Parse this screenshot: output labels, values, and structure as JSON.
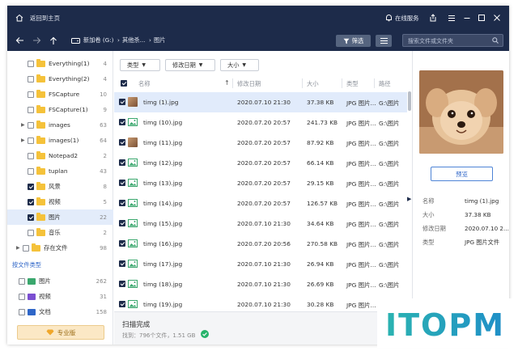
{
  "titlebar": {
    "back_home": "返回到主页",
    "online_service": "在线服务"
  },
  "nav": {
    "crumbs": [
      "新加卷 (G:)",
      "其他杀...",
      "图片"
    ],
    "filter_label": "筛选",
    "search_placeholder": "搜索文件或文件夹"
  },
  "sidebar": {
    "folders": [
      {
        "name": "Everything(1)",
        "count": "4",
        "checked": false,
        "expandable": false
      },
      {
        "name": "Everything(2)",
        "count": "4",
        "checked": false,
        "expandable": false
      },
      {
        "name": "FSCapture",
        "count": "10",
        "checked": false,
        "expandable": false
      },
      {
        "name": "FSCapture(1)",
        "count": "9",
        "checked": false,
        "expandable": false
      },
      {
        "name": "images",
        "count": "63",
        "checked": false,
        "expandable": true
      },
      {
        "name": "images(1)",
        "count": "64",
        "checked": false,
        "expandable": true
      },
      {
        "name": "Notepad2",
        "count": "2",
        "checked": false,
        "expandable": false
      },
      {
        "name": "tuplan",
        "count": "43",
        "checked": false,
        "expandable": false
      },
      {
        "name": "风景",
        "count": "8",
        "checked": true,
        "expandable": false
      },
      {
        "name": "视频",
        "count": "5",
        "checked": true,
        "expandable": false
      },
      {
        "name": "图片",
        "count": "22",
        "checked": true,
        "expandable": false,
        "selected": true
      },
      {
        "name": "音乐",
        "count": "2",
        "checked": false,
        "expandable": false
      }
    ],
    "saved_files": {
      "name": "存在文件",
      "count": "98"
    },
    "by_type_title": "按文件类型",
    "types": [
      {
        "name": "图片",
        "count": "262",
        "color": "#3aa76d"
      },
      {
        "name": "视频",
        "count": "31",
        "color": "#7b4fd1"
      },
      {
        "name": "文档",
        "count": "158",
        "color": "#2f66c8"
      }
    ],
    "pro_label": "专业版"
  },
  "filters": {
    "type": "类型",
    "modified": "修改日期",
    "size": "大小"
  },
  "table": {
    "headers": {
      "name": "名称",
      "modified": "修改日期",
      "size": "大小",
      "type": "类型",
      "path": "路径"
    },
    "rows": [
      {
        "name": "timg (1).jpg",
        "modified": "2020.07.10 21:30",
        "size": "37.38 KB",
        "type": "JPG 图片...",
        "path": "G:\\图片",
        "thumb": true
      },
      {
        "name": "timg (10).jpg",
        "modified": "2020.07.20 20:57",
        "size": "241.73 KB",
        "type": "JPG 图片...",
        "path": "G:\\图片",
        "thumb": false
      },
      {
        "name": "timg (11).jpg",
        "modified": "2020.07.20 20:57",
        "size": "87.92 KB",
        "type": "JPG 图片...",
        "path": "G:\\图片",
        "thumb": true
      },
      {
        "name": "timg (12).jpg",
        "modified": "2020.07.20 20:57",
        "size": "66.14 KB",
        "type": "JPG 图片...",
        "path": "G:\\图片",
        "thumb": false
      },
      {
        "name": "timg (13).jpg",
        "modified": "2020.07.20 20:57",
        "size": "29.15 KB",
        "type": "JPG 图片...",
        "path": "G:\\图片",
        "thumb": false
      },
      {
        "name": "timg (14).jpg",
        "modified": "2020.07.20 20:57",
        "size": "126.57 KB",
        "type": "JPG 图片...",
        "path": "G:\\图片",
        "thumb": false
      },
      {
        "name": "timg (15).jpg",
        "modified": "2020.07.10 21:30",
        "size": "34.64 KB",
        "type": "JPG 图片...",
        "path": "G:\\图片",
        "thumb": false
      },
      {
        "name": "timg (16).jpg",
        "modified": "2020.07.20 20:56",
        "size": "270.58 KB",
        "type": "JPG 图片...",
        "path": "G:\\图片",
        "thumb": false
      },
      {
        "name": "timg (17).jpg",
        "modified": "2020.07.10 21:30",
        "size": "26.94 KB",
        "type": "JPG 图片...",
        "path": "G:\\图片",
        "thumb": false
      },
      {
        "name": "timg (18).jpg",
        "modified": "2020.07.10 21:30",
        "size": "26.69 KB",
        "type": "JPG 图片...",
        "path": "G:\\图片",
        "thumb": false
      },
      {
        "name": "timg (19).jpg",
        "modified": "2020.07.10 21:30",
        "size": "30.28 KB",
        "type": "JPG 图片...",
        "path": "G:\\图片",
        "thumb": false
      }
    ]
  },
  "status": {
    "title": "扫描完成",
    "found": "找到：796个文件，1.51 GB"
  },
  "preview": {
    "button": "预览",
    "fields": [
      {
        "key": "名称",
        "value": "timg (1).jpg"
      },
      {
        "key": "大小",
        "value": "37.38 KB"
      },
      {
        "key": "修改日期",
        "value": "2020.07.10 2..."
      },
      {
        "key": "类型",
        "value": "JPG 图片文件"
      }
    ]
  },
  "watermark": {
    "text": "ITOPM"
  },
  "colors": {
    "titlebar": "#1d2b4a",
    "accent": "#2f66c8",
    "selected_row": "#e1ebfb"
  }
}
